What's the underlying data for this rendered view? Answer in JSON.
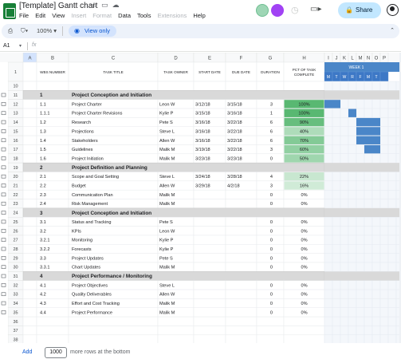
{
  "title_bar": {
    "doc_title": "[Template] Gantt chart",
    "menu": [
      "File",
      "Edit",
      "View",
      "Insert",
      "Format",
      "Data",
      "Tools",
      "Extensions",
      "Help"
    ],
    "menu_disabled": [
      false,
      false,
      false,
      true,
      true,
      false,
      false,
      true,
      false
    ],
    "share_label": "Share"
  },
  "toolbar": {
    "zoom": "100%",
    "view_only_label": "View only"
  },
  "formula_bar": {
    "cell_ref": "A1"
  },
  "grid": {
    "column_letters": [
      "A",
      "B",
      "C",
      "D",
      "E",
      "F",
      "G",
      "H",
      "I",
      "J",
      "K",
      "L",
      "M",
      "N",
      "O",
      "P"
    ],
    "headers": [
      "WBS NUMBER",
      "TASK TITLE",
      "TASK OWNER",
      "START DATE",
      "DUE DATE",
      "DURATION",
      "PCT OF TASK COMPLETE"
    ],
    "week_label": "WEEK 1",
    "day_labels": [
      "M",
      "T",
      "W",
      "R",
      "F",
      "M",
      "T"
    ],
    "accent_color": "#4a86c8",
    "section_color": "#d9d9d9",
    "rows": [
      {
        "n": "1",
        "type": "blank"
      },
      {
        "n": "10",
        "type": "blank"
      },
      {
        "n": "11",
        "type": "section",
        "wbs": "1",
        "title": "Project Conception and Initiation"
      },
      {
        "n": "12",
        "type": "task",
        "wbs": "1.1",
        "title": "Project Charter",
        "owner": "Leon W",
        "start": "3/12/18",
        "due": "3/15/18",
        "dur": "3",
        "pct": "100%",
        "pv": 1.0,
        "bar": [
          0,
          2
        ]
      },
      {
        "n": "13",
        "type": "task",
        "wbs": "1.1.1",
        "title": "Project Charter Revisions",
        "owner": "Kylie P",
        "start": "3/15/18",
        "due": "3/16/18",
        "dur": "1",
        "pct": "100%",
        "pv": 1.0,
        "bar": [
          3,
          1
        ]
      },
      {
        "n": "14",
        "type": "task",
        "wbs": "1.2",
        "title": "Research",
        "owner": "Pete S",
        "start": "3/16/18",
        "due": "3/22/18",
        "dur": "6",
        "pct": "90%",
        "pv": 0.9,
        "bar": [
          4,
          3
        ]
      },
      {
        "n": "15",
        "type": "task",
        "wbs": "1.3",
        "title": "Projections",
        "owner": "Steve L",
        "start": "3/16/18",
        "due": "3/22/18",
        "dur": "6",
        "pct": "40%",
        "pv": 0.4,
        "bar": [
          4,
          3
        ]
      },
      {
        "n": "16",
        "type": "task",
        "wbs": "1.4",
        "title": "Stakeholders",
        "owner": "Allen W",
        "start": "3/16/18",
        "due": "3/22/18",
        "dur": "6",
        "pct": "70%",
        "pv": 0.7,
        "bar": [
          4,
          3
        ]
      },
      {
        "n": "17",
        "type": "task",
        "wbs": "1.5",
        "title": "Guidelines",
        "owner": "Malik M",
        "start": "3/19/18",
        "due": "3/22/18",
        "dur": "3",
        "pct": "60%",
        "pv": 0.6,
        "bar": [
          5,
          2
        ]
      },
      {
        "n": "18",
        "type": "task",
        "wbs": "1.6",
        "title": "Project Initiation",
        "owner": "Malik M",
        "start": "3/23/18",
        "due": "3/23/18",
        "dur": "0",
        "pct": "50%",
        "pv": 0.5,
        "bar": null
      },
      {
        "n": "19",
        "type": "section",
        "wbs": "2",
        "title": "Project Definition and Planning"
      },
      {
        "n": "20",
        "type": "task",
        "wbs": "2.1",
        "title": "Scope and Goal Setting",
        "owner": "Steve L",
        "start": "3/24/18",
        "due": "3/28/18",
        "dur": "4",
        "pct": "22%",
        "pv": 0.22,
        "bar": null
      },
      {
        "n": "21",
        "type": "task",
        "wbs": "2.2",
        "title": "Budget",
        "owner": "Allen W",
        "start": "3/29/18",
        "due": "4/2/18",
        "dur": "3",
        "pct": "16%",
        "pv": 0.16,
        "bar": null
      },
      {
        "n": "22",
        "type": "task",
        "wbs": "2.3",
        "title": "Communication Plan",
        "owner": "Malik M",
        "start": "",
        "due": "",
        "dur": "0",
        "pct": "0%",
        "pv": 0,
        "bar": null
      },
      {
        "n": "23",
        "type": "task",
        "wbs": "2.4",
        "title": "Risk Management",
        "owner": "Malik M",
        "start": "",
        "due": "",
        "dur": "0",
        "pct": "0%",
        "pv": 0,
        "bar": null
      },
      {
        "n": "24",
        "type": "section",
        "wbs": "3",
        "title": "Project Conception and Initiation"
      },
      {
        "n": "25",
        "type": "task",
        "wbs": "3.1",
        "title": "Status and Tracking",
        "owner": "Pete S",
        "start": "",
        "due": "",
        "dur": "0",
        "pct": "0%",
        "pv": 0,
        "bar": null
      },
      {
        "n": "26",
        "type": "task",
        "wbs": "3.2",
        "title": "KPIs",
        "owner": "Leon W",
        "start": "",
        "due": "",
        "dur": "0",
        "pct": "0%",
        "pv": 0,
        "bar": null
      },
      {
        "n": "27",
        "type": "task",
        "wbs": "3.2.1",
        "title": "Monitoring",
        "owner": "Kylie P",
        "start": "",
        "due": "",
        "dur": "0",
        "pct": "0%",
        "pv": 0,
        "bar": null
      },
      {
        "n": "28",
        "type": "task",
        "wbs": "3.2.2",
        "title": "Forecasts",
        "owner": "Kylie P",
        "start": "",
        "due": "",
        "dur": "0",
        "pct": "0%",
        "pv": 0,
        "bar": null
      },
      {
        "n": "29",
        "type": "task",
        "wbs": "3.3",
        "title": "Project Updates",
        "owner": "Pete S",
        "start": "",
        "due": "",
        "dur": "0",
        "pct": "0%",
        "pv": 0,
        "bar": null
      },
      {
        "n": "30",
        "type": "task",
        "wbs": "3.3.1",
        "title": "Chart Updates",
        "owner": "Malik M",
        "start": "",
        "due": "",
        "dur": "0",
        "pct": "0%",
        "pv": 0,
        "bar": null
      },
      {
        "n": "31",
        "type": "section",
        "wbs": "4",
        "title": "Project Performance / Monitoring"
      },
      {
        "n": "32",
        "type": "task",
        "wbs": "4.1",
        "title": "Project Objectives",
        "owner": "Steve L",
        "start": "",
        "due": "",
        "dur": "0",
        "pct": "0%",
        "pv": 0,
        "bar": null
      },
      {
        "n": "33",
        "type": "task",
        "wbs": "4.2",
        "title": "Quality Deliverables",
        "owner": "Allen W",
        "start": "",
        "due": "",
        "dur": "0",
        "pct": "0%",
        "pv": 0,
        "bar": null
      },
      {
        "n": "34",
        "type": "task",
        "wbs": "4.3",
        "title": "Effort and Cost Tracking",
        "owner": "Malik M",
        "start": "",
        "due": "",
        "dur": "0",
        "pct": "0%",
        "pv": 0,
        "bar": null
      },
      {
        "n": "35",
        "type": "task",
        "wbs": "4.4",
        "title": "Project Performance",
        "owner": "Malik M",
        "start": "",
        "due": "",
        "dur": "0",
        "pct": "0%",
        "pv": 0,
        "bar": null
      },
      {
        "n": "36",
        "type": "blank"
      },
      {
        "n": "37",
        "type": "blank"
      },
      {
        "n": "38",
        "type": "blank"
      }
    ]
  },
  "bottom": {
    "add_label": "Add",
    "rows_value": "1000",
    "rows_text": "more rows at the bottom"
  }
}
